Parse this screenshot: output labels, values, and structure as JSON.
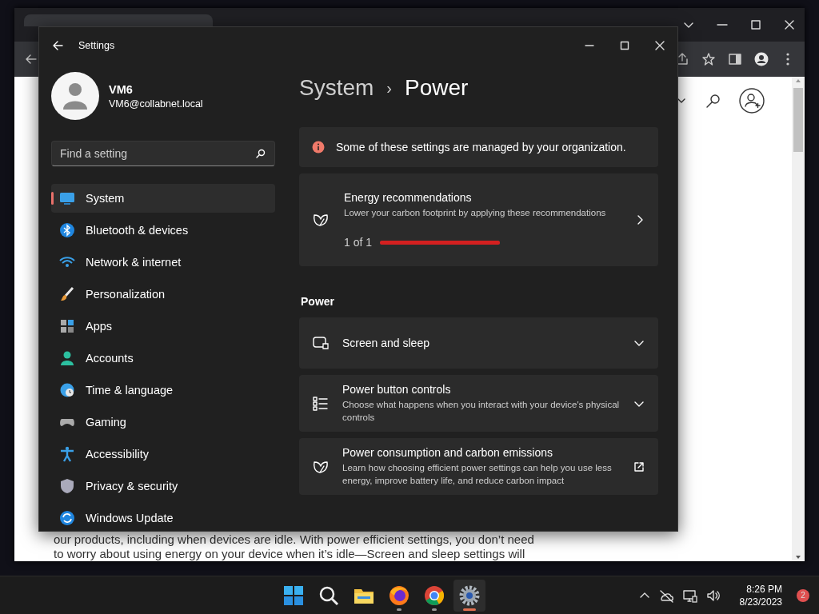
{
  "browser": {
    "page": {
      "text_lines": [
        "our products, including when devices are idle. With power efficient settings, you don’t need",
        "to worry about using energy on your device when it’s idle—Screen and sleep settings will"
      ]
    }
  },
  "settings": {
    "window": {
      "title": "Settings"
    },
    "account": {
      "name": "VM6",
      "email": "VM6@collabnet.local"
    },
    "search": {
      "placeholder": "Find a setting"
    },
    "nav": [
      {
        "label": "System",
        "selected": true
      },
      {
        "label": "Bluetooth & devices",
        "selected": false
      },
      {
        "label": "Network & internet",
        "selected": false
      },
      {
        "label": "Personalization",
        "selected": false
      },
      {
        "label": "Apps",
        "selected": false
      },
      {
        "label": "Accounts",
        "selected": false
      },
      {
        "label": "Time & language",
        "selected": false
      },
      {
        "label": "Gaming",
        "selected": false
      },
      {
        "label": "Accessibility",
        "selected": false
      },
      {
        "label": "Privacy & security",
        "selected": false
      },
      {
        "label": "Windows Update",
        "selected": false
      }
    ],
    "breadcrumb": [
      "System",
      "›",
      "Power"
    ],
    "notice": "Some of these settings are managed by your organization.",
    "energy": {
      "title": "Energy recommendations",
      "description": "Lower your carbon footprint by applying these recommendations",
      "counter": "1 of 1",
      "level": 1
    },
    "section": "Power",
    "cards": [
      {
        "kind": "expand",
        "title": "Screen and sleep"
      },
      {
        "kind": "expand",
        "title": "Power button controls",
        "description": "Choose what happens when you interact with your device's physical controls"
      },
      {
        "kind": "external",
        "title": "Power consumption and carbon emissions",
        "description": "Learn how choosing efficient power settings can help you use less energy, improve battery life, and reduce carbon impact"
      }
    ]
  },
  "taskbar": {
    "apps": [
      {
        "kind": "start",
        "selected": false,
        "running": false
      },
      {
        "kind": "search",
        "selected": false,
        "running": false
      },
      {
        "kind": "files",
        "selected": false,
        "running": false
      },
      {
        "kind": "firefox",
        "selected": false,
        "running": true
      },
      {
        "kind": "chrome",
        "selected": false,
        "running": true
      },
      {
        "kind": "settings",
        "selected": true,
        "running": true
      }
    ],
    "time": "8:26 PM",
    "date": "8/23/2023",
    "notifications": "2"
  }
}
